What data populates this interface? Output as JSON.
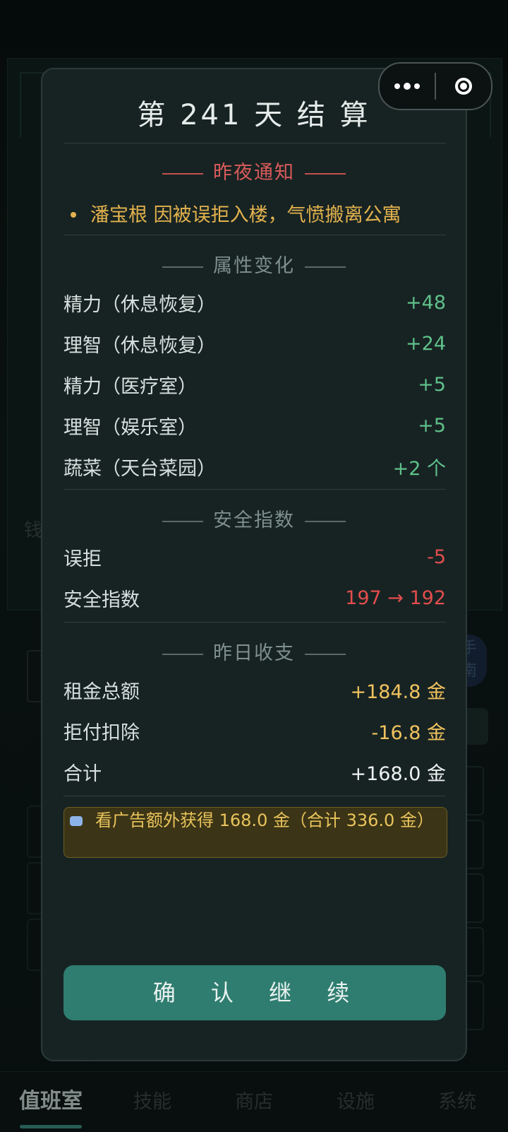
{
  "background": {
    "money_label": "钱",
    "side_pill": [
      "手",
      "南"
    ]
  },
  "capsule": {
    "more_label": "more-icon",
    "close_label": "target-icon"
  },
  "modal": {
    "title": "第 241 天  结 算",
    "notice": {
      "heading": "昨夜通知",
      "items": [
        "潘宝根 因被误拒入楼，气愤搬离公寓"
      ]
    },
    "attributes": {
      "heading": "属性变化",
      "rows": [
        {
          "label": "精力（休息恢复）",
          "value": "+48"
        },
        {
          "label": "理智（休息恢复）",
          "value": "+24"
        },
        {
          "label": "精力（医疗室）",
          "value": "+5"
        },
        {
          "label": "理智（娱乐室）",
          "value": "+5"
        },
        {
          "label": "蔬菜（天台菜园）",
          "value": "+2 个"
        }
      ]
    },
    "safety": {
      "heading": "安全指数",
      "rows": [
        {
          "label": "误拒",
          "value": "-5"
        },
        {
          "label": "安全指数",
          "value": "197 → 192"
        }
      ]
    },
    "finance": {
      "heading": "昨日收支",
      "rows": [
        {
          "label": "租金总额",
          "value": "+184.8 金"
        },
        {
          "label": "拒付扣除",
          "value": "-16.8 金"
        },
        {
          "label": "合计",
          "value": "+168.0 金"
        }
      ]
    },
    "ad_offer": "看广告额外获得 168.0 金（合计 336.0 金）",
    "confirm_label": "确 认 继 续"
  },
  "tabbar": {
    "tabs": [
      {
        "label": "值班室",
        "active": true
      },
      {
        "label": "技能",
        "active": false
      },
      {
        "label": "商店",
        "active": false
      },
      {
        "label": "设施",
        "active": false
      },
      {
        "label": "系统",
        "active": false
      }
    ]
  },
  "colors": {
    "positive": "#5fc08a",
    "negative": "#e24d4d",
    "gold": "#f0c25e",
    "accent": "#2f7d70"
  }
}
